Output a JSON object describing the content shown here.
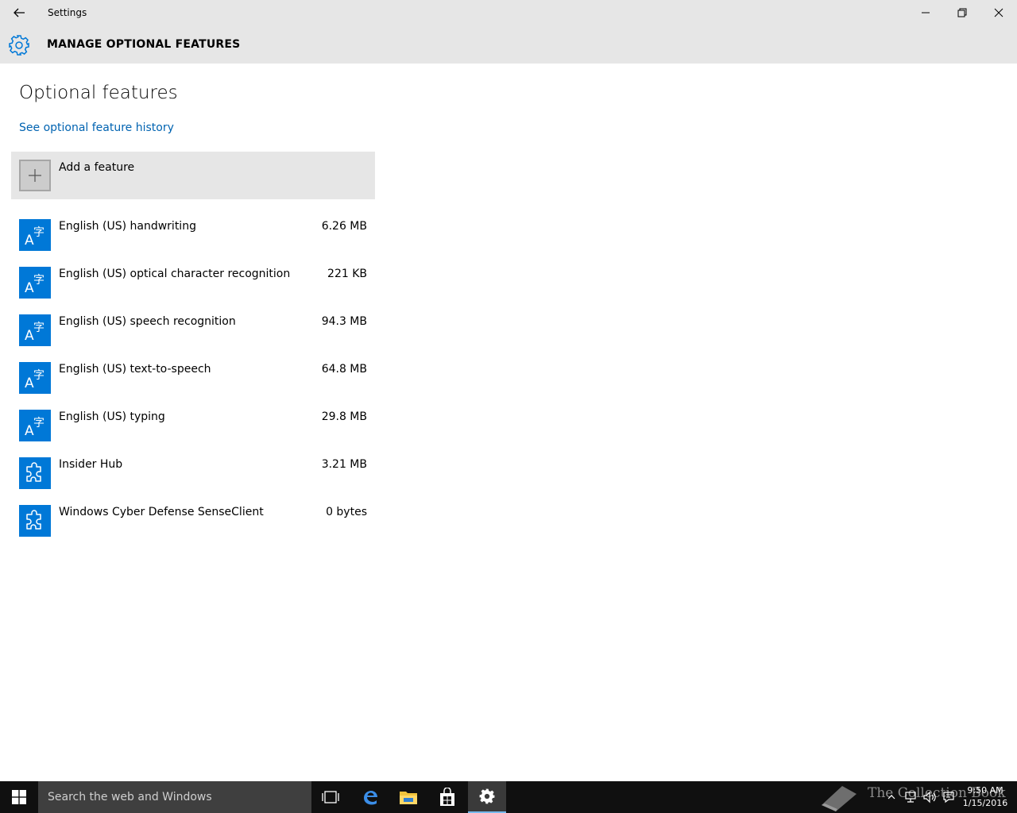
{
  "window": {
    "title": "Settings"
  },
  "header": {
    "title": "MANAGE OPTIONAL FEATURES"
  },
  "main": {
    "title": "Optional features",
    "history_link": "See optional feature history",
    "add_feature_label": "Add a feature",
    "features": [
      {
        "name": "English (US) handwriting",
        "size": "6.26 MB",
        "icon": "language-icon"
      },
      {
        "name": "English (US) optical character recognition",
        "size": "221 KB",
        "icon": "language-icon"
      },
      {
        "name": "English (US) speech recognition",
        "size": "94.3 MB",
        "icon": "language-icon"
      },
      {
        "name": "English (US) text-to-speech",
        "size": "64.8 MB",
        "icon": "language-icon"
      },
      {
        "name": "English (US) typing",
        "size": "29.8 MB",
        "icon": "language-icon"
      },
      {
        "name": "Insider Hub",
        "size": "3.21 MB",
        "icon": "puzzle-icon"
      },
      {
        "name": "Windows Cyber Defense SenseClient",
        "size": "0 bytes",
        "icon": "puzzle-icon"
      }
    ]
  },
  "taskbar": {
    "search_placeholder": "Search the web and Windows",
    "clock_time": "9:50 AM",
    "clock_date": "1/15/2016",
    "watermark_text": "The Collection Book"
  },
  "colors": {
    "accent": "#0078d7",
    "link": "#0063b1",
    "chrome": "#e6e6e6",
    "taskbar": "#101010"
  }
}
